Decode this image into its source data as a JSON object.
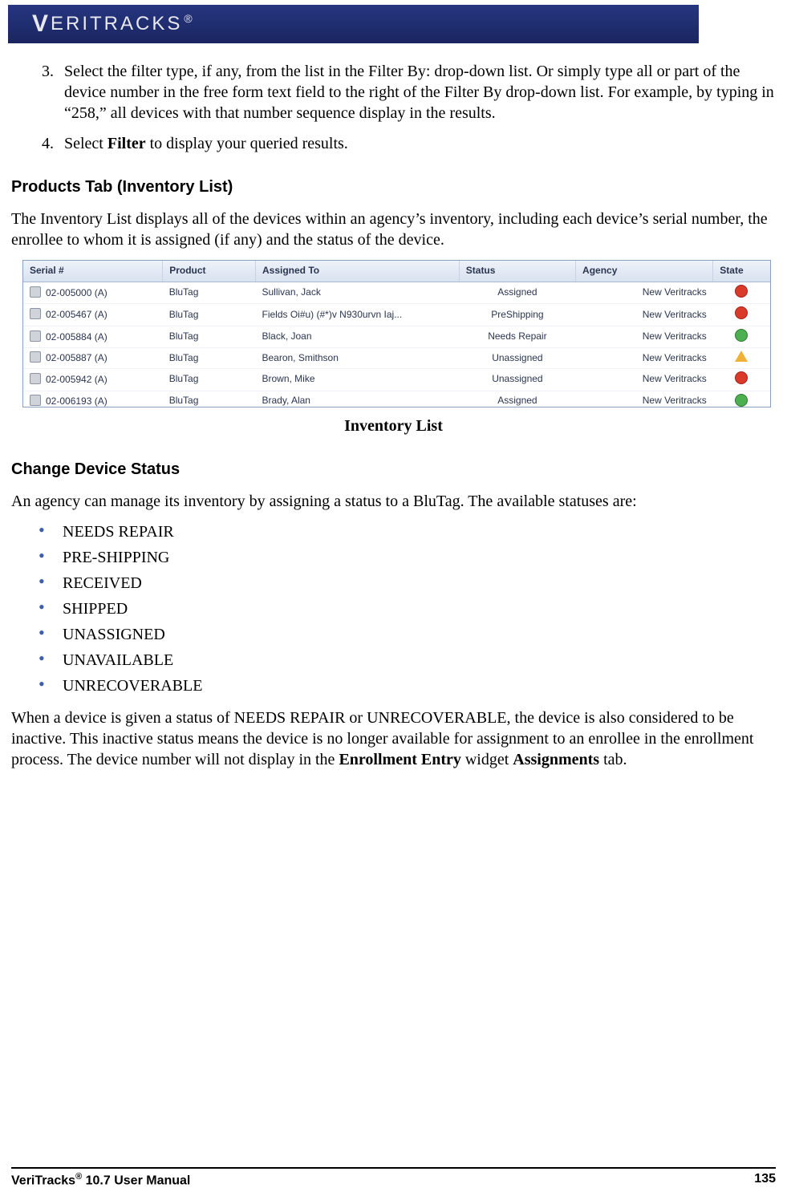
{
  "header": {
    "brand": "VERITRACKS",
    "reg": "®"
  },
  "steps": {
    "item3": "Select the filter type, if any, from the list in the Filter By: drop-down list. Or simply type all or part of the device number in the free form text field to the right of the Filter By drop-down list. For example, by typing in “258,” all devices with that number sequence display in the results.",
    "item4_pre": "Select ",
    "item4_bold": "Filter",
    "item4_post": " to display your queried results."
  },
  "section1": {
    "heading": "Products Tab (Inventory List)",
    "intro": "The Inventory List displays all of the devices within an agency’s inventory, including each device’s serial number, the enrollee to whom it is assigned (if any) and the status of the device.",
    "caption": "Inventory List"
  },
  "table": {
    "headers": {
      "serial": "Serial #",
      "product": "Product",
      "assigned": "Assigned To",
      "status": "Status",
      "agency": "Agency",
      "state": "State"
    },
    "rows": [
      {
        "serial": "02-005000 (A)",
        "product": "BluTag",
        "assigned": "Sullivan, Jack",
        "status": "Assigned",
        "agency": "New Veritracks",
        "state": "red"
      },
      {
        "serial": "02-005467 (A)",
        "product": "BluTag",
        "assigned": "Fields Oi#u) (#*)v N930urvn Iaj...",
        "status": "PreShipping",
        "agency": "New Veritracks",
        "state": "red"
      },
      {
        "serial": "02-005884 (A)",
        "product": "BluTag",
        "assigned": "Black, Joan",
        "status": "Needs Repair",
        "agency": "New Veritracks",
        "state": "green"
      },
      {
        "serial": "02-005887 (A)",
        "product": "BluTag",
        "assigned": "Bearon, Smithson",
        "status": "Unassigned",
        "agency": "New Veritracks",
        "state": "yellow"
      },
      {
        "serial": "02-005942 (A)",
        "product": "BluTag",
        "assigned": "Brown, Mike",
        "status": "Unassigned",
        "agency": "New Veritracks",
        "state": "red"
      },
      {
        "serial": "02-006193 (A)",
        "product": "BluTag",
        "assigned": "Brady, Alan",
        "status": "Assigned",
        "agency": "New Veritracks",
        "state": "green"
      }
    ]
  },
  "section2": {
    "heading": "Change Device Status",
    "intro": "An agency can manage its inventory by assigning a status to a BluTag. The available statuses are:",
    "statuses": [
      "NEEDS REPAIR",
      "PRE-SHIPPING",
      "RECEIVED",
      "SHIPPED",
      "UNASSIGNED",
      "UNAVAILABLE",
      "UNRECOVERABLE"
    ],
    "outro_pre": "When a device is given a status of NEEDS REPAIR or UNRECOVERABLE, the device is also considered to be inactive. This inactive status means the device is no longer available for assignment to an enrollee in the enrollment process. The device number will not display in the ",
    "outro_b1": "Enrollment Entry",
    "outro_mid": " widget ",
    "outro_b2": "Assignments",
    "outro_post": " tab."
  },
  "footer": {
    "left_pre": "VeriTracks",
    "left_sup": "®",
    "left_post": " 10.7 User Manual",
    "page": "135"
  }
}
